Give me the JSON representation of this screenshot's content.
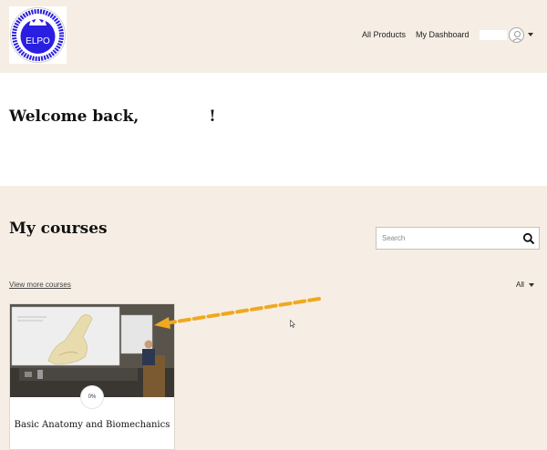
{
  "header": {
    "logo_text": "ELPO",
    "logo_ring_text": "EQUINE LAMENESS PREVENTION ORGANIZATION",
    "nav": [
      {
        "label": "All Products"
      },
      {
        "label": "My Dashboard"
      }
    ],
    "user_icon": "user-avatar-icon",
    "menu_icon": "caret-down-icon"
  },
  "welcome": {
    "text": "Welcome back,             !"
  },
  "courses": {
    "heading": "My courses",
    "search_placeholder": "Search",
    "search_icon": "magnifier-icon",
    "view_more": "View more courses",
    "filter_label": "All",
    "items": [
      {
        "title": "Basic Anatomy and Biomechanics",
        "progress": "0%"
      }
    ]
  },
  "colors": {
    "background": "#f6eee4",
    "band": "#ffffff",
    "logo_blue": "#2a1fe0",
    "arrow": "#f0a81e"
  }
}
